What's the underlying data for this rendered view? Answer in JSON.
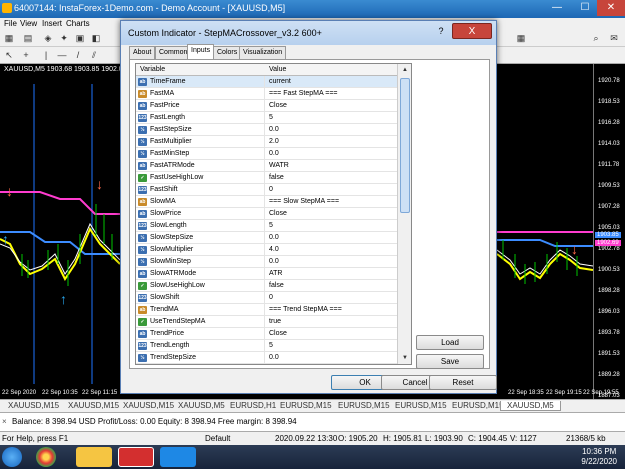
{
  "window": {
    "title": "64007144: InstaForex-1Demo.com - Demo Account - [XAUUSD,M5]",
    "menu": [
      "File",
      "View",
      "Insert",
      "Charts"
    ]
  },
  "chart": {
    "title": "XAUUSD,M5  1903.68 1903.85 1902.03 1902.17",
    "price_levels": [
      "1920.78",
      "1918.53",
      "1916.28",
      "1914.03",
      "1911.78",
      "1909.53",
      "1907.28",
      "1905.03",
      "1902.78",
      "1900.53",
      "1898.28",
      "1896.03",
      "1893.78",
      "1891.53",
      "1889.28",
      "1887.03"
    ],
    "price_highlight_1": "1903.85",
    "price_highlight_2": "1902.69",
    "time_labels": [
      "22 Sep 2020",
      "22 Sep 10:35",
      "22 Sep 11:15",
      "22 Sep 18:35",
      "22 Sep 19:15",
      "22 Sep 19:55"
    ],
    "colors": {
      "magenta": "#ff3ccf",
      "blue": "#3c8cff",
      "yellow": "#ffff00",
      "white": "#ffffff",
      "green": "#00c400",
      "up_arrow": "#29a8f0",
      "down_arrow": "#ff6a4a"
    }
  },
  "chart_tabs": [
    "XAUUSD,M15",
    "XAUUSD,M15",
    "XAUUSD,M15",
    "XAUUSD,M5",
    "EURUSD,H1",
    "EURUSD,M15",
    "EURUSD,M15",
    "EURUSD,M15",
    "EURUSD,M15",
    "XAUUSD,M5"
  ],
  "terminal": {
    "balance": "Balance: 8 398.94 USD  Profit/Loss: 0.00  Equity: 8 398.94  Free margin: 8 398.94"
  },
  "status": {
    "help": "For Help, press F1",
    "profile": "Default",
    "time": "2020.09.22 13:30",
    "open": "O: 1905.20",
    "high": "H: 1905.81",
    "low": "L: 1903.90",
    "close": "C: 1904.45",
    "volume": "V: 1127",
    "traffic": "21368/5 kb"
  },
  "taskbar": {
    "time": "10:36 PM",
    "date": "9/22/2020"
  },
  "dialog": {
    "title": "Custom Indicator - StepMACrossover_v3.2 600+",
    "help": "?",
    "close": "X",
    "tabs": [
      "About",
      "Common",
      "Inputs",
      "Colors",
      "Visualization"
    ],
    "header_variable": "Variable",
    "header_value": "Value",
    "rows": [
      {
        "icon": "ab",
        "type_color": "#3c6fb0",
        "name": "TimeFrame",
        "value": "current"
      },
      {
        "icon": "ab",
        "type_color": "#c98b2a",
        "name": "FastMA",
        "value": "=== Fast StepMA ==="
      },
      {
        "icon": "ab",
        "type_color": "#3c6fb0",
        "name": "FastPrice",
        "value": "Close"
      },
      {
        "icon": "123",
        "type_color": "#3c6fb0",
        "name": "FastLength",
        "value": "5"
      },
      {
        "icon": "½",
        "type_color": "#3c6fb0",
        "name": "FastStepSize",
        "value": "0.0"
      },
      {
        "icon": "½",
        "type_color": "#3c6fb0",
        "name": "FastMultiplier",
        "value": "2.0"
      },
      {
        "icon": "½",
        "type_color": "#3c6fb0",
        "name": "FastMinStep",
        "value": "0.0"
      },
      {
        "icon": "ab",
        "type_color": "#3c6fb0",
        "name": "FastATRMode",
        "value": "WATR"
      },
      {
        "icon": "✓",
        "type_color": "#3a9a3a",
        "name": "FastUseHighLow",
        "value": "false"
      },
      {
        "icon": "123",
        "type_color": "#3c6fb0",
        "name": "FastShift",
        "value": "0"
      },
      {
        "icon": "ab",
        "type_color": "#c98b2a",
        "name": "SlowMA",
        "value": "=== Slow StepMA ==="
      },
      {
        "icon": "ab",
        "type_color": "#3c6fb0",
        "name": "SlowPrice",
        "value": "Close"
      },
      {
        "icon": "123",
        "type_color": "#3c6fb0",
        "name": "SlowLength",
        "value": "5"
      },
      {
        "icon": "½",
        "type_color": "#3c6fb0",
        "name": "SlowStepSize",
        "value": "0.0"
      },
      {
        "icon": "½",
        "type_color": "#3c6fb0",
        "name": "SlowMultiplier",
        "value": "4.0"
      },
      {
        "icon": "½",
        "type_color": "#3c6fb0",
        "name": "SlowMinStep",
        "value": "0.0"
      },
      {
        "icon": "ab",
        "type_color": "#3c6fb0",
        "name": "SlowATRMode",
        "value": "ATR"
      },
      {
        "icon": "✓",
        "type_color": "#3a9a3a",
        "name": "SlowUseHighLow",
        "value": "false"
      },
      {
        "icon": "123",
        "type_color": "#3c6fb0",
        "name": "SlowShift",
        "value": "0"
      },
      {
        "icon": "ab",
        "type_color": "#c98b2a",
        "name": "TrendMA",
        "value": "=== Trend StepMA ==="
      },
      {
        "icon": "✓",
        "type_color": "#3a9a3a",
        "name": "UseTrendStepMA",
        "value": "true"
      },
      {
        "icon": "ab",
        "type_color": "#3c6fb0",
        "name": "TrendPrice",
        "value": "Close"
      },
      {
        "icon": "123",
        "type_color": "#3c6fb0",
        "name": "TrendLength",
        "value": "5"
      },
      {
        "icon": "½",
        "type_color": "#3c6fb0",
        "name": "TrendStepSize",
        "value": "0.0"
      }
    ],
    "load": "Load",
    "save": "Save",
    "ok": "OK",
    "cancel": "Cancel",
    "reset": "Reset"
  }
}
